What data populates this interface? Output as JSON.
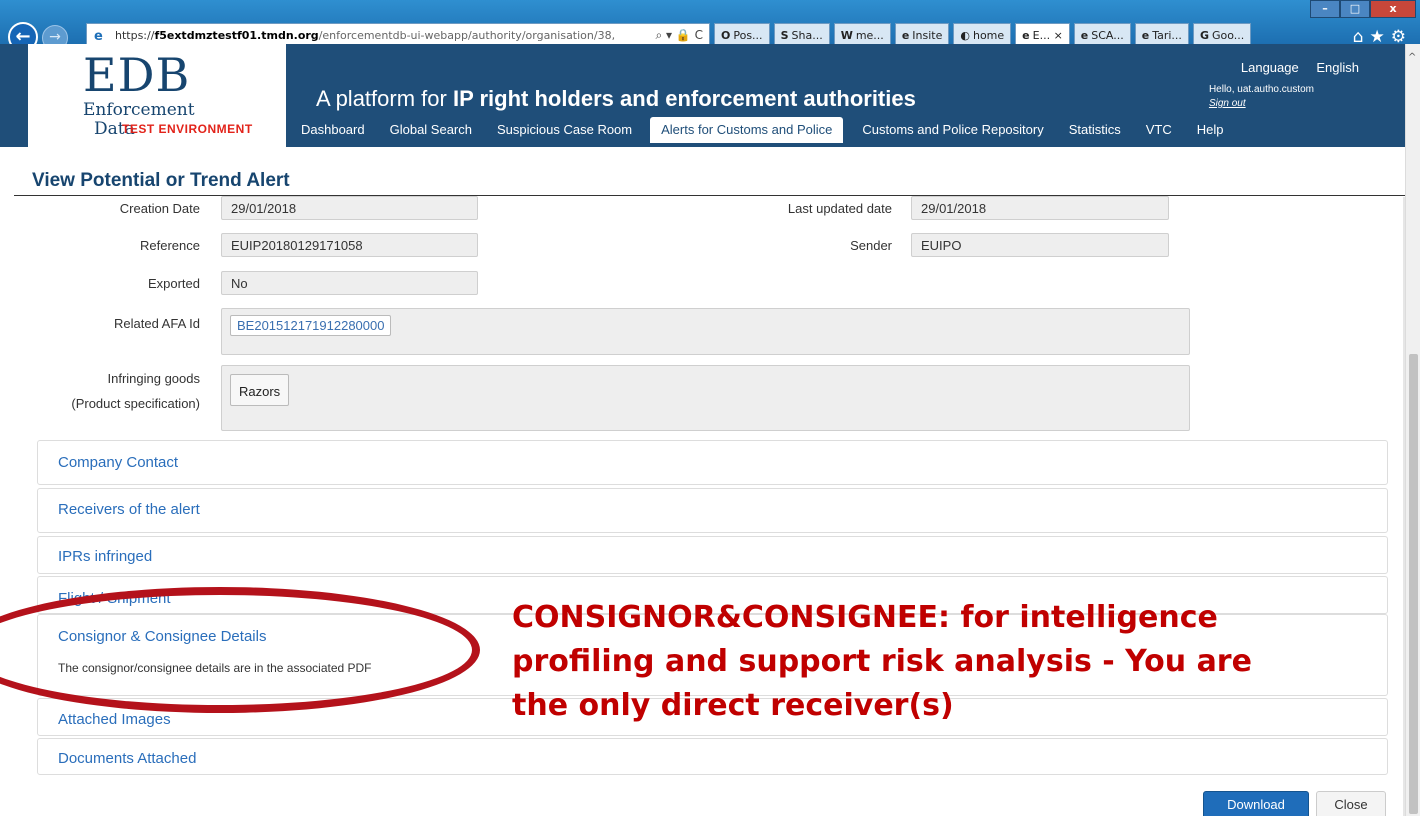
{
  "browser": {
    "url_prefix": "https://",
    "url_domain": "f5extdmztestf01.tmdn.org",
    "url_path": "/enforcementdb-ui-webapp/authority/organisation/38,",
    "addr_controls": "⌕ ▾ 🔒 C",
    "tabs": [
      {
        "icon": "O",
        "label": "Pos...",
        "active": false
      },
      {
        "icon": "S",
        "label": "Sha...",
        "active": false
      },
      {
        "icon": "W",
        "label": "me...",
        "active": false
      },
      {
        "icon": "e",
        "label": "Insite",
        "active": false
      },
      {
        "icon": "◐",
        "label": "home",
        "active": false
      },
      {
        "icon": "e",
        "label": "E... ×",
        "active": true
      },
      {
        "icon": "e",
        "label": "SCA...",
        "active": false
      },
      {
        "icon": "e",
        "label": "Tari...",
        "active": false
      },
      {
        "icon": "G",
        "label": "Goo...",
        "active": false
      }
    ],
    "window_controls": {
      "minimize": "–",
      "maximize": "□",
      "close": "x"
    },
    "tools": "⌂★⚙"
  },
  "header": {
    "logo_main": "EDB",
    "logo_line1": "Enforcement",
    "logo_line2": "Data",
    "env_label": "TEST ENVIRONMENT",
    "tagline_prefix": "A platform for ",
    "tagline_bold": "IP right holders and enforcement authorities",
    "language_label": "Language",
    "language_value": "English",
    "greeting": "Hello, uat.autho.custom",
    "sign_out": "Sign out"
  },
  "menu": [
    {
      "label": "Dashboard",
      "active": false
    },
    {
      "label": "Global Search",
      "active": false
    },
    {
      "label": "Suspicious Case Room",
      "active": false
    },
    {
      "label": "Alerts for Customs and Police",
      "active": true
    },
    {
      "label": "Customs and Police Repository",
      "active": false
    },
    {
      "label": "Statistics",
      "active": false
    },
    {
      "label": "VTC",
      "active": false
    },
    {
      "label": "Help",
      "active": false
    }
  ],
  "page": {
    "title": "View Potential or Trend Alert"
  },
  "form": {
    "creation_date": {
      "label": "Creation Date",
      "value": "29/01/2018"
    },
    "last_updated": {
      "label": "Last updated date",
      "value": "29/01/2018"
    },
    "reference": {
      "label": "Reference",
      "value": "EUIP20180129171058"
    },
    "sender": {
      "label": "Sender",
      "value": "EUIPO"
    },
    "exported": {
      "label": "Exported",
      "value": "No"
    },
    "related_afa": {
      "label": "Related AFA Id",
      "value": "BE201512171912280000"
    },
    "infringing_goods": {
      "label_line1": "Infringing goods",
      "label_line2": "(Product specification)",
      "value": "Razors"
    }
  },
  "panels": {
    "company_contact": "Company Contact",
    "receivers": "Receivers of the alert",
    "iprs": "IPRs infringed",
    "flight": "Flight / Shipment",
    "consignor": "Consignor & Consignee Details",
    "consignor_body": "The consignor/consignee details are in the associated PDF",
    "images": "Attached Images",
    "documents": "Documents Attached"
  },
  "annotation": {
    "text": "CONSIGNOR&CONSIGNEE: for intelligence\nprofiling and support risk analysis - You are\nthe only direct receiver(s)"
  },
  "buttons": {
    "download": "Download",
    "close": "Close"
  },
  "colors": {
    "header_bg": "#1f4e79",
    "link_blue": "#2a6ebb",
    "annotation_red": "#c00000",
    "primary_button": "#1f6dba"
  }
}
